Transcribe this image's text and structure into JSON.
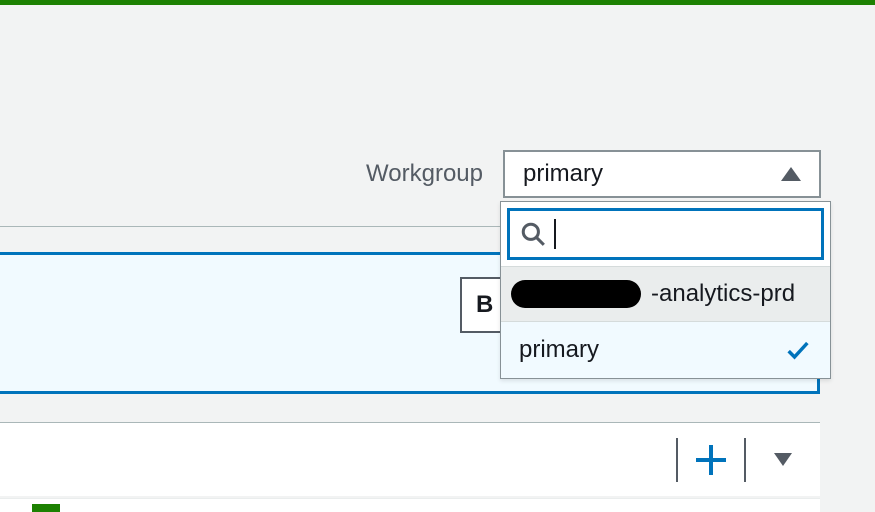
{
  "workgroup": {
    "label": "Workgroup",
    "selected": "primary"
  },
  "search": {
    "value": ""
  },
  "options": [
    {
      "label": "-analytics-prd",
      "selected": false,
      "hovered": true,
      "redacted": true
    },
    {
      "label": "primary",
      "selected": true,
      "hovered": false,
      "redacted": false
    }
  ],
  "partial_button": "B"
}
